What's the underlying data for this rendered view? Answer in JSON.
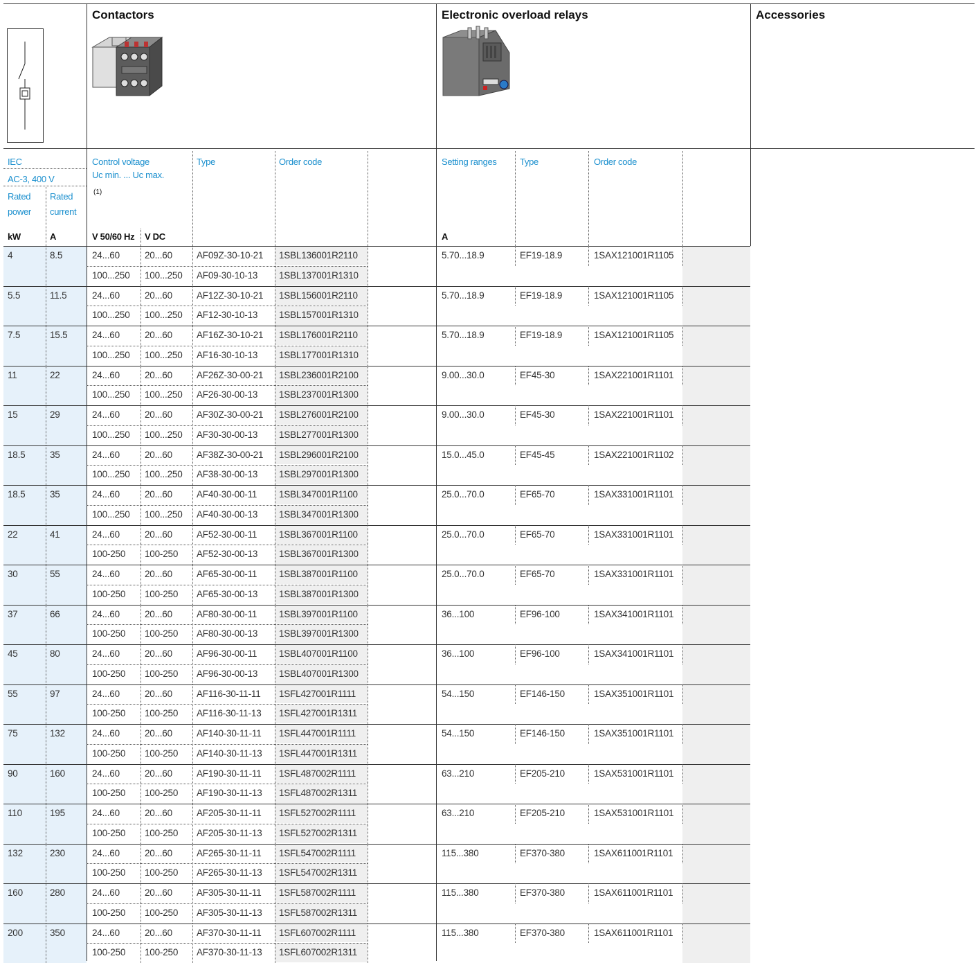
{
  "titles": {
    "contactors": "Contactors",
    "overload": "Electronic overload relays",
    "accessories": "Accessories"
  },
  "headers": {
    "iec": "IEC",
    "ac3": "AC-3, 400 V",
    "rated_power_1": "Rated",
    "rated_power_2": "power",
    "rated_current_1": "Rated",
    "rated_current_2": "current",
    "control_voltage_1": "Control voltage",
    "control_voltage_2": "Uc min. ... Uc max.",
    "footnote": "(1)",
    "type": "Type",
    "order_code": "Order code",
    "setting_ranges": "Setting ranges",
    "type2": "Type",
    "order_code2": "Order code",
    "unit_kw": "kW",
    "unit_a": "A",
    "unit_vac": "V 50/60 Hz",
    "unit_vdc": "V DC",
    "unit_a2": "A"
  },
  "colors": {
    "accent": "#1a8fce",
    "band_blue": "#e6f1fa",
    "band_gray": "#efefef"
  },
  "rows": [
    {
      "kw": "4",
      "a": "8.5",
      "ac1": "24...60",
      "dc1": "20...60",
      "type1": "AF09Z-30-10-21",
      "code1": "1SBL136001R2110",
      "ac2": "100...250",
      "dc2": "100...250",
      "type2": "AF09-30-10-13",
      "code2": "1SBL137001R1310",
      "range": "5.70...18.9",
      "otype": "EF19-18.9",
      "ocode": "1SAX121001R1105"
    },
    {
      "kw": "5.5",
      "a": "11.5",
      "ac1": "24...60",
      "dc1": "20...60",
      "type1": "AF12Z-30-10-21",
      "code1": "1SBL156001R2110",
      "ac2": "100...250",
      "dc2": "100...250",
      "type2": "AF12-30-10-13",
      "code2": "1SBL157001R1310",
      "range": "5.70...18.9",
      "otype": "EF19-18.9",
      "ocode": "1SAX121001R1105"
    },
    {
      "kw": "7.5",
      "a": "15.5",
      "ac1": "24...60",
      "dc1": "20...60",
      "type1": "AF16Z-30-10-21",
      "code1": "1SBL176001R2110",
      "ac2": "100...250",
      "dc2": "100...250",
      "type2": "AF16-30-10-13",
      "code2": "1SBL177001R1310",
      "range": "5.70...18.9",
      "otype": "EF19-18.9",
      "ocode": "1SAX121001R1105"
    },
    {
      "kw": "11",
      "a": "22",
      "ac1": "24...60",
      "dc1": "20...60",
      "type1": "AF26Z-30-00-21",
      "code1": "1SBL236001R2100",
      "ac2": "100...250",
      "dc2": "100...250",
      "type2": "AF26-30-00-13",
      "code2": "1SBL237001R1300",
      "range": "9.00...30.0",
      "otype": "EF45-30",
      "ocode": "1SAX221001R1101"
    },
    {
      "kw": "15",
      "a": "29",
      "ac1": "24...60",
      "dc1": "20...60",
      "type1": "AF30Z-30-00-21",
      "code1": "1SBL276001R2100",
      "ac2": "100...250",
      "dc2": "100...250",
      "type2": "AF30-30-00-13",
      "code2": "1SBL277001R1300",
      "range": "9.00...30.0",
      "otype": "EF45-30",
      "ocode": "1SAX221001R1101"
    },
    {
      "kw": "18.5",
      "a": "35",
      "ac1": "24...60",
      "dc1": "20...60",
      "type1": "AF38Z-30-00-21",
      "code1": "1SBL296001R2100",
      "ac2": "100...250",
      "dc2": "100...250",
      "type2": "AF38-30-00-13",
      "code2": "1SBL297001R1300",
      "range": "15.0...45.0",
      "otype": "EF45-45",
      "ocode": "1SAX221001R1102"
    },
    {
      "kw": "18.5",
      "a": "35",
      "ac1": "24...60",
      "dc1": "20...60",
      "type1": "AF40-30-00-11",
      "code1": "1SBL347001R1100",
      "ac2": "100...250",
      "dc2": "100...250",
      "type2": "AF40-30-00-13",
      "code2": "1SBL347001R1300",
      "range": "25.0...70.0",
      "otype": "EF65-70",
      "ocode": "1SAX331001R1101"
    },
    {
      "kw": "22",
      "a": "41",
      "ac1": "24...60",
      "dc1": "20...60",
      "type1": "AF52-30-00-11",
      "code1": "1SBL367001R1100",
      "ac2": "100-250",
      "dc2": "100-250",
      "type2": "AF52-30-00-13",
      "code2": "1SBL367001R1300",
      "range": "25.0...70.0",
      "otype": "EF65-70",
      "ocode": "1SAX331001R1101"
    },
    {
      "kw": "30",
      "a": "55",
      "ac1": "24...60",
      "dc1": "20...60",
      "type1": "AF65-30-00-11",
      "code1": "1SBL387001R1100",
      "ac2": "100-250",
      "dc2": "100-250",
      "type2": "AF65-30-00-13",
      "code2": "1SBL387001R1300",
      "range": "25.0...70.0",
      "otype": "EF65-70",
      "ocode": "1SAX331001R1101"
    },
    {
      "kw": "37",
      "a": "66",
      "ac1": "24...60",
      "dc1": "20...60",
      "type1": "AF80-30-00-11",
      "code1": "1SBL397001R1100",
      "ac2": "100-250",
      "dc2": "100-250",
      "type2": "AF80-30-00-13",
      "code2": "1SBL397001R1300",
      "range": "36...100",
      "otype": "EF96-100",
      "ocode": "1SAX341001R1101"
    },
    {
      "kw": "45",
      "a": "80",
      "ac1": "24...60",
      "dc1": "20...60",
      "type1": "AF96-30-00-11",
      "code1": "1SBL407001R1100",
      "ac2": "100-250",
      "dc2": "100-250",
      "type2": "AF96-30-00-13",
      "code2": "1SBL407001R1300",
      "range": "36...100",
      "otype": "EF96-100",
      "ocode": "1SAX341001R1101"
    },
    {
      "kw": "55",
      "a": "97",
      "ac1": "24...60",
      "dc1": "20...60",
      "type1": "AF116-30-11-11",
      "code1": "1SFL427001R1111",
      "ac2": "100-250",
      "dc2": "100-250",
      "type2": "AF116-30-11-13",
      "code2": "1SFL427001R1311",
      "range": "54...150",
      "otype": "EF146-150",
      "ocode": "1SAX351001R1101"
    },
    {
      "kw": "75",
      "a": "132",
      "ac1": "24...60",
      "dc1": "20...60",
      "type1": "AF140-30-11-11",
      "code1": "1SFL447001R1111",
      "ac2": "100-250",
      "dc2": "100-250",
      "type2": "AF140-30-11-13",
      "code2": "1SFL447001R1311",
      "range": "54...150",
      "otype": "EF146-150",
      "ocode": "1SAX351001R1101"
    },
    {
      "kw": "90",
      "a": "160",
      "ac1": "24...60",
      "dc1": "20...60",
      "type1": "AF190-30-11-11",
      "code1": "1SFL487002R1111",
      "ac2": "100-250",
      "dc2": "100-250",
      "type2": "AF190-30-11-13",
      "code2": "1SFL487002R1311",
      "range": "63...210",
      "otype": "EF205-210",
      "ocode": "1SAX531001R1101"
    },
    {
      "kw": "110",
      "a": "195",
      "ac1": "24...60",
      "dc1": "20...60",
      "type1": "AF205-30-11-11",
      "code1": "1SFL527002R1111",
      "ac2": "100-250",
      "dc2": "100-250",
      "type2": "AF205-30-11-13",
      "code2": "1SFL527002R1311",
      "range": "63...210",
      "otype": "EF205-210",
      "ocode": "1SAX531001R1101"
    },
    {
      "kw": "132",
      "a": "230",
      "ac1": "24...60",
      "dc1": "20...60",
      "type1": "AF265-30-11-11",
      "code1": "1SFL547002R1111",
      "ac2": "100-250",
      "dc2": "100-250",
      "type2": "AF265-30-11-13",
      "code2": "1SFL547002R1311",
      "range": "115...380",
      "otype": "EF370-380",
      "ocode": "1SAX611001R1101"
    },
    {
      "kw": "160",
      "a": "280",
      "ac1": "24...60",
      "dc1": "20...60",
      "type1": "AF305-30-11-11",
      "code1": "1SFL587002R1111",
      "ac2": "100-250",
      "dc2": "100-250",
      "type2": "AF305-30-11-13",
      "code2": "1SFL587002R1311",
      "range": "115...380",
      "otype": "EF370-380",
      "ocode": "1SAX611001R1101"
    },
    {
      "kw": "200",
      "a": "350",
      "ac1": "24...60",
      "dc1": "20...60",
      "type1": "AF370-30-11-11",
      "code1": "1SFL607002R1111",
      "ac2": "100-250",
      "dc2": "100-250",
      "type2": "AF370-30-11-13",
      "code2": "1SFL607002R1311",
      "range": "115...380",
      "otype": "EF370-380",
      "ocode": "1SAX611001R1101"
    }
  ]
}
